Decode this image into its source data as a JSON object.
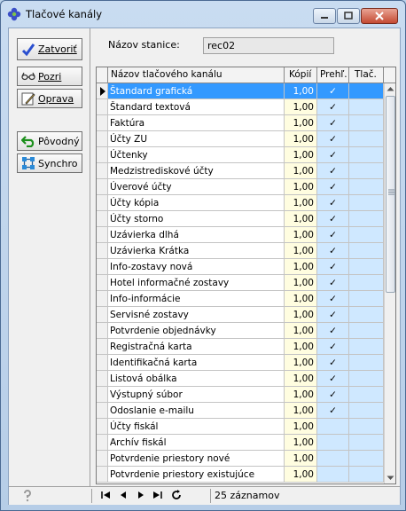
{
  "window": {
    "title": "Tlačové kanály"
  },
  "toolbar": {
    "close_label": "Zatvoriť",
    "view_label": "Pozri",
    "edit_label": "Oprava",
    "original_label": "Pôvodný",
    "sync_label": "Synchro"
  },
  "station": {
    "label": "Názov stanice:",
    "value": "rec02"
  },
  "grid": {
    "headers": [
      "Názov tlačového kanálu",
      "Kópií",
      "Prehľ.",
      "Tlač."
    ],
    "rows": [
      {
        "name": "Štandard grafická",
        "copies": "1,00",
        "preview": "✓"
      },
      {
        "name": "Štandard textová",
        "copies": "1,00",
        "preview": "✓"
      },
      {
        "name": "Faktúra",
        "copies": "1,00",
        "preview": "✓"
      },
      {
        "name": "Účty ZU",
        "copies": "1,00",
        "preview": "✓"
      },
      {
        "name": "Účtenky",
        "copies": "1,00",
        "preview": "✓"
      },
      {
        "name": "Medzistrediskové účty",
        "copies": "1,00",
        "preview": "✓"
      },
      {
        "name": "Úverové účty",
        "copies": "1,00",
        "preview": "✓"
      },
      {
        "name": "Účty kópia",
        "copies": "1,00",
        "preview": "✓"
      },
      {
        "name": "Účty storno",
        "copies": "1,00",
        "preview": "✓"
      },
      {
        "name": "Uzávierka dlhá",
        "copies": "1,00",
        "preview": "✓"
      },
      {
        "name": "Uzávierka Krátka",
        "copies": "1,00",
        "preview": "✓"
      },
      {
        "name": "Info-zostavy nová",
        "copies": "1,00",
        "preview": "✓"
      },
      {
        "name": "Hotel informačné zostavy",
        "copies": "1,00",
        "preview": "✓"
      },
      {
        "name": "Info-informácie",
        "copies": "1,00",
        "preview": "✓"
      },
      {
        "name": "Servisné zostavy",
        "copies": "1,00",
        "preview": "✓"
      },
      {
        "name": "Potvrdenie objednávky",
        "copies": "1,00",
        "preview": "✓"
      },
      {
        "name": "Registračná karta",
        "copies": "1,00",
        "preview": "✓"
      },
      {
        "name": "Identifikačná karta",
        "copies": "1,00",
        "preview": "✓"
      },
      {
        "name": "Listová obálka",
        "copies": "1,00",
        "preview": "✓"
      },
      {
        "name": "Výstupný súbor",
        "copies": "1,00",
        "preview": "✓"
      },
      {
        "name": "Odoslanie e-mailu",
        "copies": "1,00",
        "preview": "✓"
      },
      {
        "name": "Účty fiskál",
        "copies": "1,00",
        "preview": ""
      },
      {
        "name": "Archív fiskál",
        "copies": "1,00",
        "preview": ""
      },
      {
        "name": "Potvrdenie priestory nové",
        "copies": "1,00",
        "preview": ""
      },
      {
        "name": "Potvrdenie priestory existujúce",
        "copies": "1,00",
        "preview": ""
      }
    ]
  },
  "status": {
    "records": "25 záznamov"
  }
}
